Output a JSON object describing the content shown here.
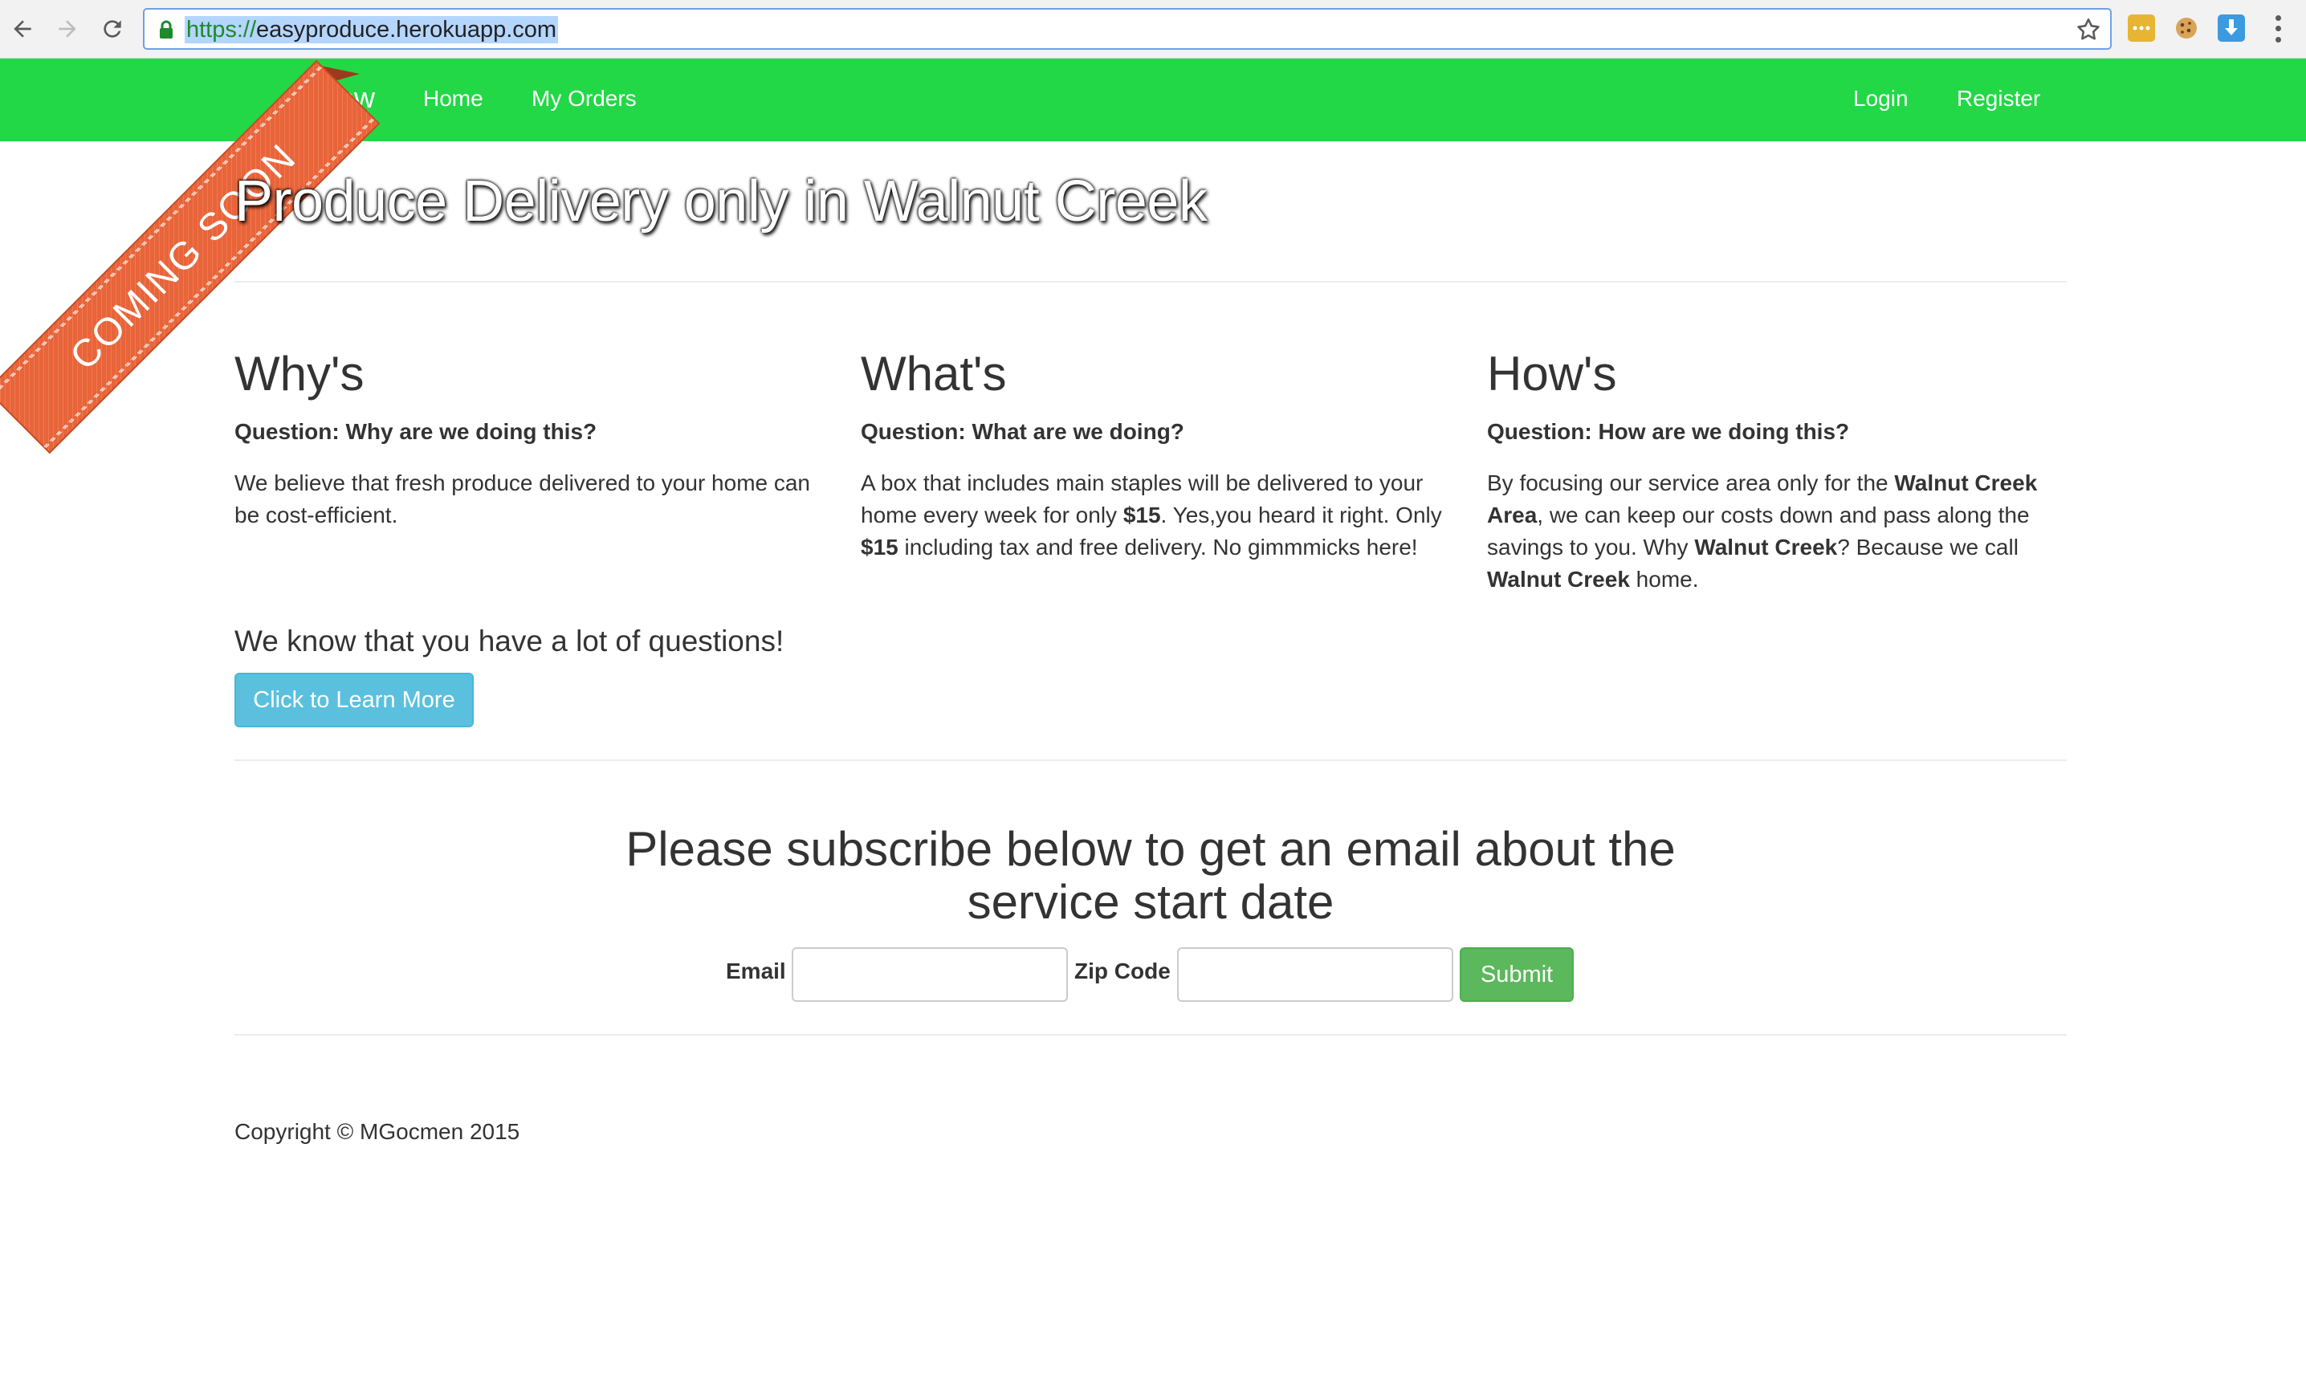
{
  "browser": {
    "url_scheme": "https://",
    "url_host": "easyproduce.herokuapp.com"
  },
  "navbar": {
    "brand": "Now",
    "links": [
      "Home",
      "My Orders"
    ],
    "right_links": [
      "Login",
      "Register"
    ],
    "color": "#22d846"
  },
  "ribbon": {
    "text": "COMING SOON",
    "color": "#e8643a"
  },
  "hero": {
    "title": "Produce Delivery only in Walnut Creek"
  },
  "columns": [
    {
      "heading": "Why's",
      "question": "Question: Why are we doing this?",
      "body": [
        "We believe that fresh produce delivered to your home can be cost-efficient."
      ]
    },
    {
      "heading": "What's",
      "question": "Question: What are we doing?",
      "body": [
        "A box that includes main staples will be delivered to your home every week for only ",
        "$15",
        ". Yes,you heard it right. Only ",
        "$15",
        " including tax and free delivery. No gimmmicks here!"
      ]
    },
    {
      "heading": "How's",
      "question": "Question: How are we doing this?",
      "body": [
        "By focusing our service area only for the ",
        "Walnut Creek Area",
        ", we can keep our costs down and pass along the savings to you. Why ",
        "Walnut Creek",
        "? Because we call ",
        "Walnut Creek",
        " home."
      ]
    }
  ],
  "questions": {
    "text": "We know that you have a lot of questions!",
    "button": "Click to Learn More"
  },
  "subscribe": {
    "title": "Please subscribe below to get an email about the service start date",
    "email_label": "Email",
    "zip_label": "Zip Code",
    "submit": "Submit"
  },
  "footer": {
    "copyright": "Copyright © MGocmen 2015"
  }
}
